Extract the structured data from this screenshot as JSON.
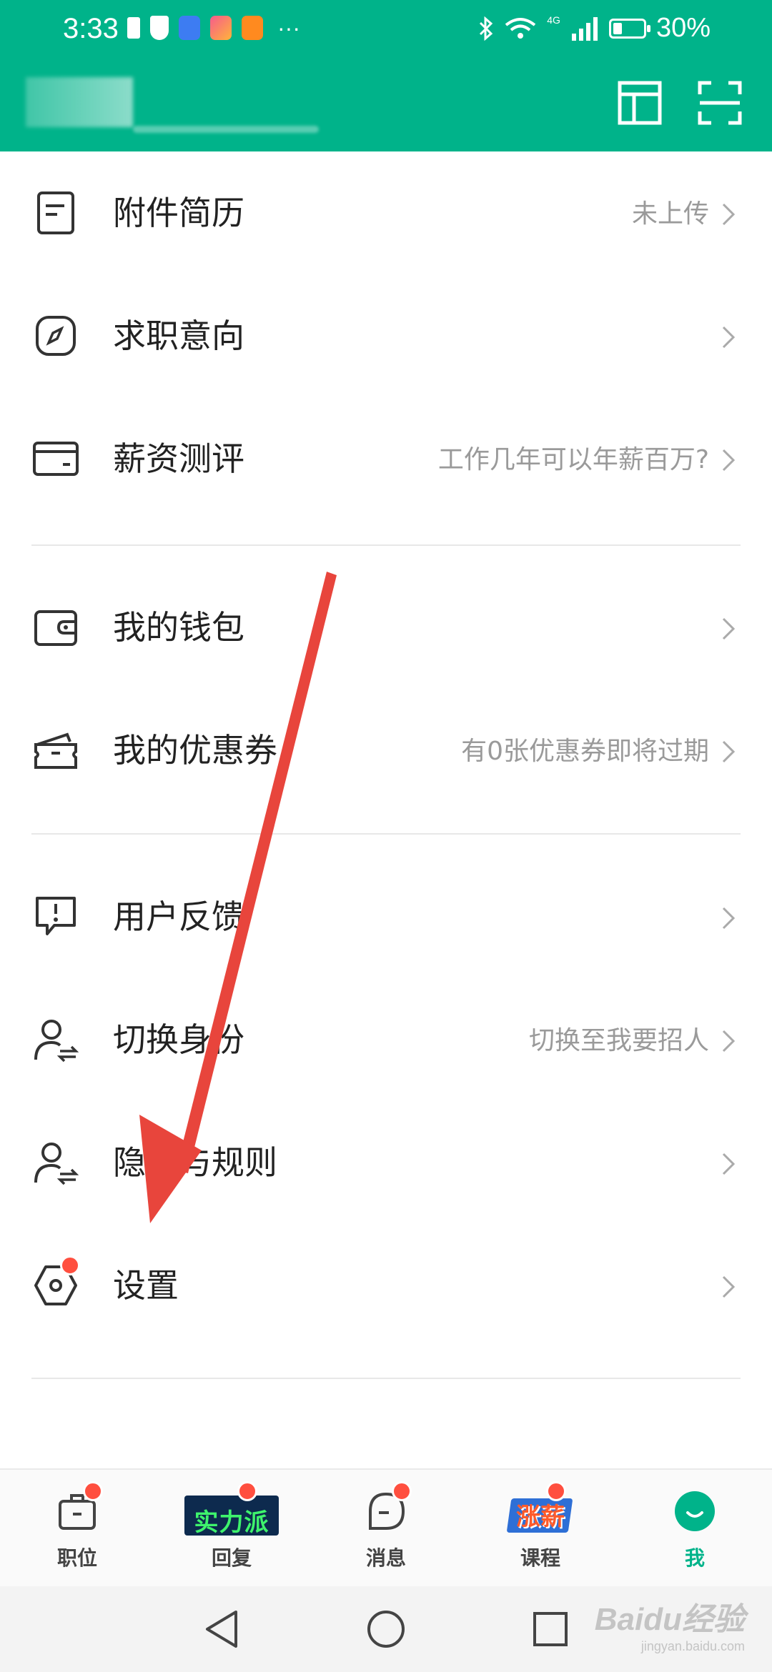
{
  "status_bar": {
    "time": "3:33",
    "battery": "30%",
    "battery_level": 0.3,
    "network": "4G",
    "more": "···",
    "notification_icons": [
      "sim-icon",
      "shield-icon",
      "qq-icon",
      "app-icon",
      "video-icon"
    ]
  },
  "header": {
    "user_name_blurred": true,
    "actions": [
      "layout-icon",
      "scan-icon"
    ]
  },
  "menu": {
    "items": [
      {
        "icon": "resume-icon",
        "label": "附件简历",
        "value": "未上传"
      },
      {
        "icon": "compass-icon",
        "label": "求职意向",
        "value": ""
      },
      {
        "icon": "card-icon",
        "label": "薪资测评",
        "value": "工作几年可以年薪百万?"
      },
      {
        "icon": "wallet-icon",
        "label": "我的钱包",
        "value": ""
      },
      {
        "icon": "coupon-icon",
        "label": "我的优惠券",
        "value": "有0张优惠券即将过期"
      },
      {
        "icon": "feedback-icon",
        "label": "用户反馈",
        "value": ""
      },
      {
        "icon": "switch-user-icon",
        "label": "切换身份",
        "value": "切换至我要招人"
      },
      {
        "icon": "privacy-icon",
        "label": "隐私与规则",
        "value": ""
      },
      {
        "icon": "settings-icon",
        "label": "设置",
        "value": "",
        "badge": true
      }
    ]
  },
  "tabbar": {
    "tabs": [
      {
        "label": "职位",
        "icon": "briefcase-icon",
        "badge": true,
        "active": false
      },
      {
        "label": "回复",
        "icon": "banner-icon",
        "banner_text": "实力派",
        "badge": true,
        "active": false
      },
      {
        "label": "消息",
        "icon": "chat-icon",
        "badge": true,
        "active": false
      },
      {
        "label": "课程",
        "icon": "book-icon",
        "banner_text": "涨薪",
        "badge": true,
        "active": false
      },
      {
        "label": "我",
        "icon": "smile-icon",
        "badge": false,
        "active": true
      }
    ]
  },
  "colors": {
    "brand": "#00b38a",
    "badge": "#ff4f3f",
    "annotation_arrow": "#e8453c"
  },
  "watermark": {
    "text": "Baidu经验",
    "sub": "jingyan.baidu.com"
  }
}
